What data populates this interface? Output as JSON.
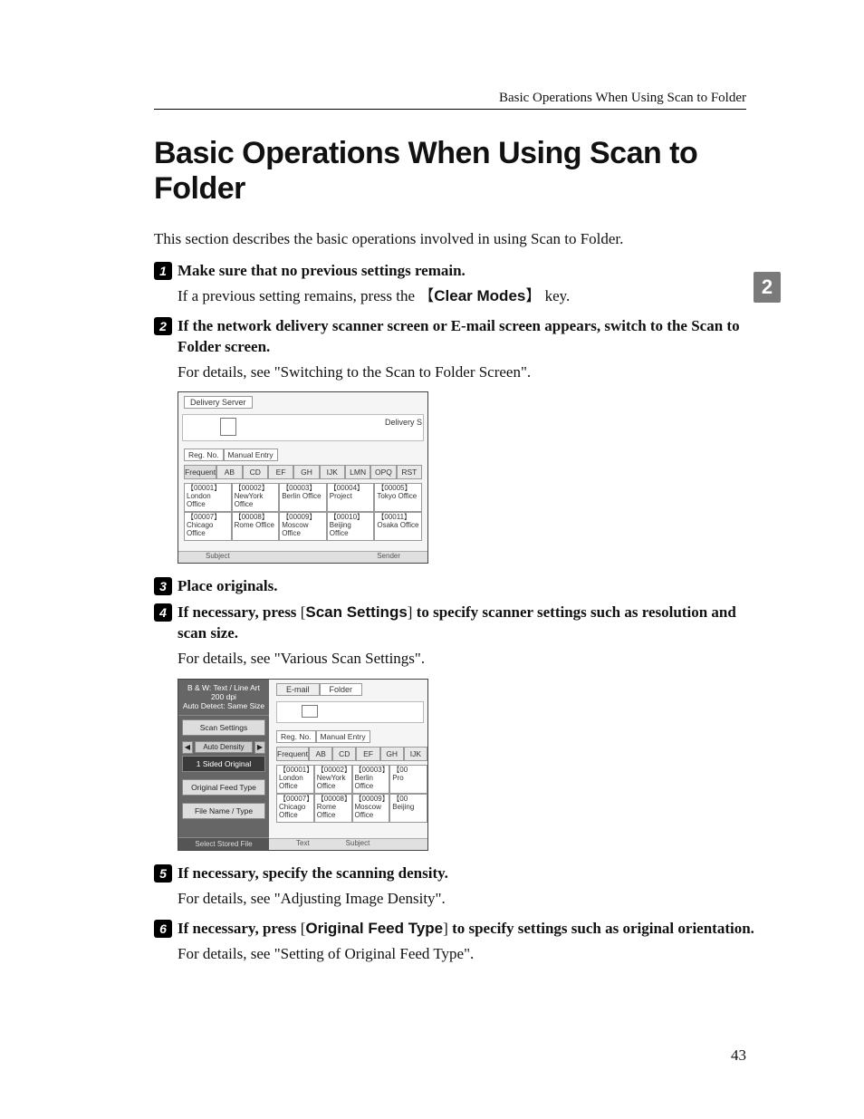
{
  "running_head": "Basic Operations When Using Scan to Folder",
  "title": "Basic Operations When Using Scan to Folder",
  "intro": "This section describes the basic operations involved in using Scan to Folder.",
  "side_tab": "2",
  "page_number": "43",
  "keys": {
    "clear_modes": "Clear Modes",
    "scan_settings": "Scan Settings",
    "original_feed_type": "Original Feed Type"
  },
  "steps": {
    "s1": {
      "num": "1",
      "title": "Make sure that no previous settings remain.",
      "body_a": "If a previous setting remains, press the ",
      "body_b": " key."
    },
    "s2": {
      "num": "2",
      "title": "If the network delivery scanner screen or E-mail screen appears, switch to the Scan to Folder screen.",
      "body": "For details, see \"Switching to the Scan to Folder Screen\"."
    },
    "s3": {
      "num": "3",
      "title": "Place originals."
    },
    "s4": {
      "num": "4",
      "title_a": "If necessary, press ",
      "title_b": " to specify scanner settings such as resolution and scan size.",
      "body": "For details, see \"Various Scan Settings\"."
    },
    "s5": {
      "num": "5",
      "title": "If necessary, specify the scanning density.",
      "body": "For details, see \"Adjusting Image Density\"."
    },
    "s6": {
      "num": "6",
      "title_a": "If necessary, press ",
      "title_b": " to specify settings such as original orientation.",
      "body": "For details, see \"Setting of Original Feed Type\"."
    }
  },
  "shot1": {
    "tab": "Delivery Server",
    "right_label": "Delivery S",
    "reg": [
      "Reg. No.",
      "Manual Entry"
    ],
    "alpha": [
      "Frequent",
      "AB",
      "CD",
      "EF",
      "GH",
      "IJK",
      "LMN",
      "OPQ",
      "RST"
    ],
    "row1": [
      "【00001】\nLondon Office",
      "【00002】\nNewYork Office",
      "【00003】\nBerlin Office",
      "【00004】\nProject",
      "【00005】\nTokyo Office"
    ],
    "row2": [
      "【00007】\nChicago Office",
      "【00008】\nRome Office",
      "【00009】\nMoscow Office",
      "【00010】\nBeijing Office",
      "【00011】\nOsaka Office"
    ],
    "bottom_left": "Subject",
    "bottom_right": "Sender"
  },
  "shot2": {
    "left": {
      "mode_line1": "B & W: Text / Line Art",
      "mode_line2": "200 dpi",
      "mode_line3": "Auto Detect: Same Size",
      "scan_settings": "Scan Settings",
      "auto_density": "Auto Density",
      "sided": "1 Sided Original",
      "feed": "Original Feed Type",
      "file": "File Name / Type",
      "footer": "Select Stored File"
    },
    "tabs": [
      "E-mail",
      "Folder"
    ],
    "reg": [
      "Reg. No.",
      "Manual Entry"
    ],
    "alpha": [
      "Frequent",
      "AB",
      "CD",
      "EF",
      "GH",
      "IJK"
    ],
    "row1": [
      "【00001】\nLondon Office",
      "【00002】\nNewYork Office",
      "【00003】\nBerlin Office",
      "【00\nPro"
    ],
    "row2": [
      "【00007】\nChicago Office",
      "【00008】\nRome Office",
      "【00009】\nMoscow Office",
      "【00\nBeijing"
    ],
    "bottom_left": "Text",
    "bottom_right": "Subject"
  }
}
